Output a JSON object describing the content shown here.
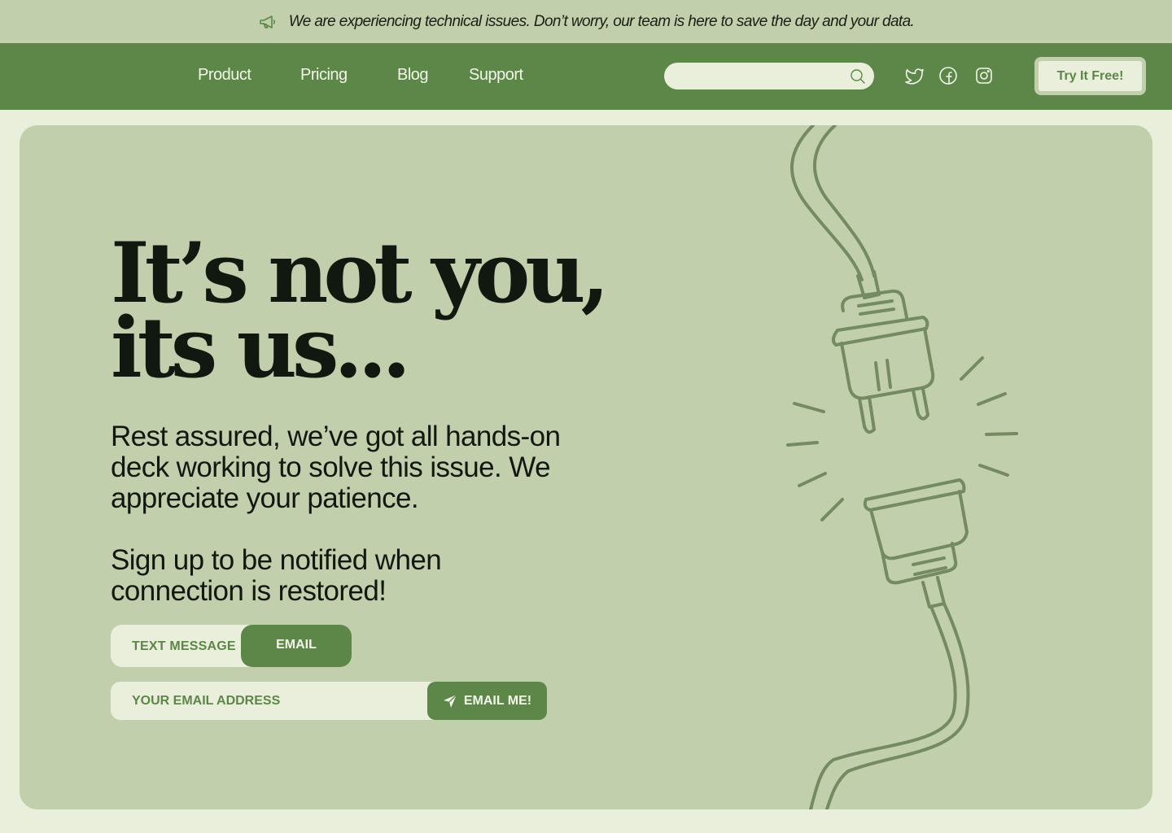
{
  "announcement": {
    "text": "We are experiencing technical issues. Don’t worry, our team is here to save the day and your data.",
    "icon": "megaphone-icon"
  },
  "nav": {
    "links": [
      "Product",
      "Pricing",
      "Blog",
      "Support"
    ],
    "search_placeholder": "",
    "social_icons": [
      "twitter-icon",
      "facebook-icon",
      "instagram-icon"
    ],
    "cta_label": "Try It Free!"
  },
  "hero": {
    "headline_line1": "It’s not you,",
    "headline_line2": "its us...",
    "body": "Rest assured, we’ve got all hands-on deck working to solve this issue. We appreciate your patience.",
    "signup_prompt": "Sign up to be notified when connection is restored!",
    "toggle": {
      "option_text": "TEXT MESSAGE",
      "option_email": "EMAIL",
      "selected": "EMAIL"
    },
    "email_placeholder": "YOUR EMAIL ADDRESS",
    "submit_label": "EMAIL ME!",
    "illustration": "unplugged-cable-illustration"
  },
  "colors": {
    "page_bg": "#e9efda",
    "bar_bg": "#c1cfac",
    "brand_green": "#5c8748",
    "text_dark": "#111810",
    "illustration_stroke": "#738a63"
  }
}
